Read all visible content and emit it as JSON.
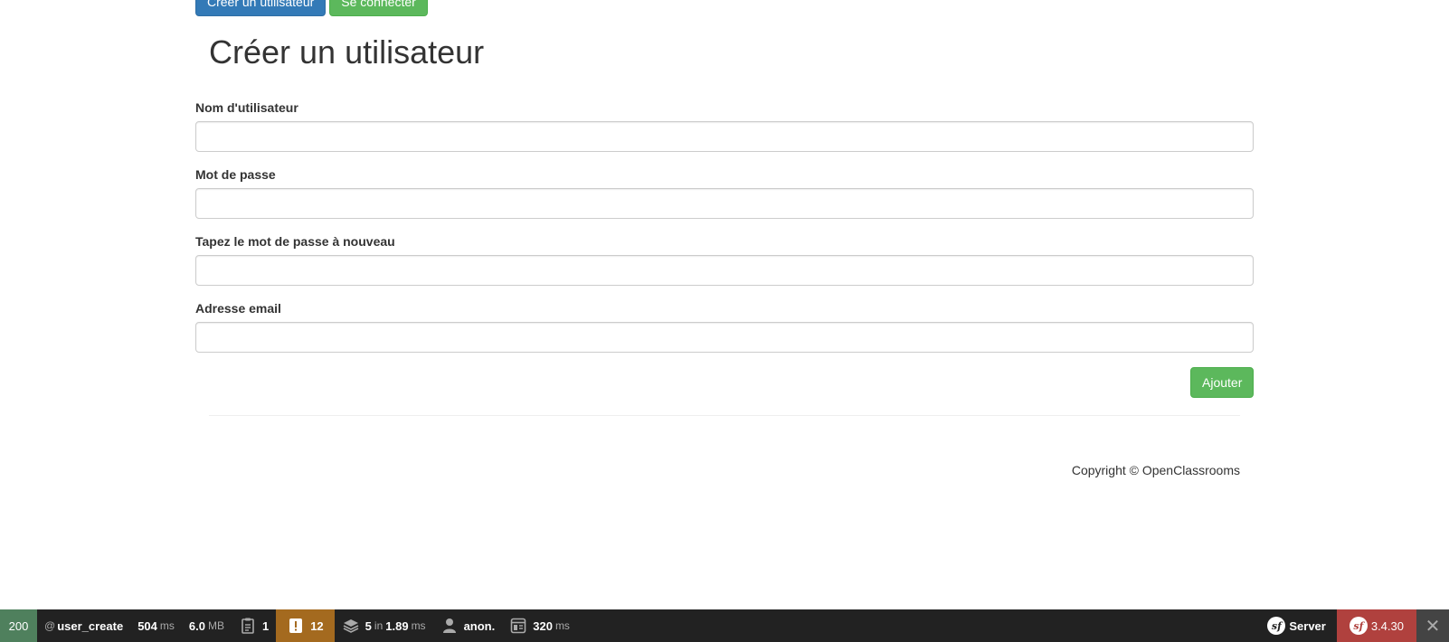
{
  "nav": {
    "create_user_label": "Créer un utilisateur",
    "login_label": "Se connecter"
  },
  "page": {
    "title": "Créer un utilisateur"
  },
  "form": {
    "username_label": "Nom d'utilisateur",
    "username_value": "",
    "password_label": "Mot de passe",
    "password_value": "",
    "password_repeat_label": "Tapez le mot de passe à nouveau",
    "password_repeat_value": "",
    "email_label": "Adresse email",
    "email_value": "",
    "submit_label": "Ajouter"
  },
  "footer": {
    "copyright": "Copyright © OpenClassrooms"
  },
  "toolbar": {
    "status_code": "200",
    "route_prefix": "@",
    "route": "user_create",
    "time_value": "504",
    "time_unit": "ms",
    "memory_value": "6.0",
    "memory_unit": "MB",
    "logs_count": "1",
    "warnings_count": "12",
    "cache_count": "5",
    "cache_in": "in",
    "cache_time": "1.89",
    "cache_unit": "ms",
    "user": "anon.",
    "twig_time": "320",
    "twig_unit": "ms",
    "server_label": "Server",
    "symfony_version": "3.4.30",
    "colors": {
      "status_ok": "#4f805d",
      "warning": "#a46a1f",
      "version": "#b0413e"
    }
  }
}
